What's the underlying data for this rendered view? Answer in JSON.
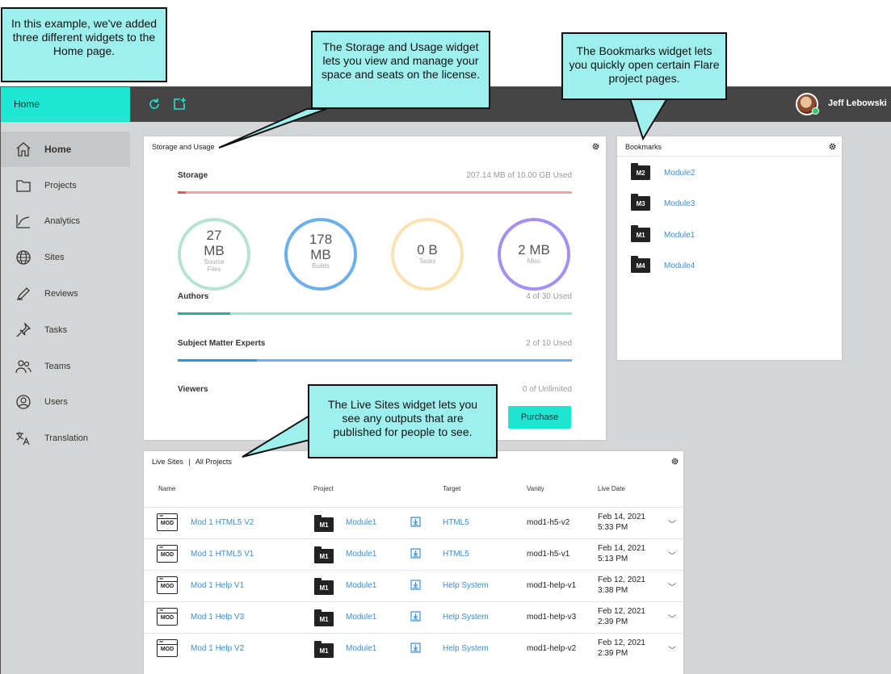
{
  "topbar": {
    "home_tab": "Home",
    "user_name": "Jeff Lebowski",
    "icons": [
      "refresh-icon",
      "new-item-icon"
    ]
  },
  "sidebar": {
    "items": [
      {
        "label": "Home",
        "icon": "home-icon",
        "active": true
      },
      {
        "label": "Projects",
        "icon": "folder-icon"
      },
      {
        "label": "Analytics",
        "icon": "chart-icon"
      },
      {
        "label": "Sites",
        "icon": "globe-icon"
      },
      {
        "label": "Reviews",
        "icon": "pen-icon"
      },
      {
        "label": "Tasks",
        "icon": "pin-icon"
      },
      {
        "label": "Teams",
        "icon": "team-icon"
      },
      {
        "label": "Users",
        "icon": "user-icon"
      },
      {
        "label": "Translation",
        "icon": "translate-icon"
      }
    ]
  },
  "storage": {
    "title": "Storage and Usage",
    "storage_label": "Storage",
    "storage_used": "207.14 MB of 10.00 GB Used",
    "storage_fraction": 0.02,
    "rings": [
      {
        "value": "27",
        "unit": "MB",
        "label": "Source Files",
        "color": "#b7e3d3",
        "accent": "#a9d8c7"
      },
      {
        "value": "178",
        "unit": "MB",
        "label": "Builds",
        "color": "#6ab0ee",
        "accent": "#3b8fd6"
      },
      {
        "value": "0 B",
        "unit": "",
        "label": "Tasks",
        "color": "#fbe2b3",
        "accent": "#f5cf85"
      },
      {
        "value": "2 MB",
        "unit": "",
        "label": "Misc",
        "color": "#a78ef2",
        "accent": "#8b6de8"
      }
    ],
    "authors_label": "Authors",
    "authors_used": "4 of 30 Used",
    "authors_fraction": 0.133,
    "sme_label": "Subject Matter Experts",
    "sme_used": "2 of 10 Used",
    "sme_fraction": 0.2,
    "viewers_label": "Viewers",
    "viewers_used": "0 of Unlimited",
    "purchase": "Purchase",
    "colors": {
      "storage": "#f2a3a3",
      "storage_fill": "#e05a5a",
      "authors": "#a8ded3",
      "authors_fill": "#1eb39a",
      "sme": "#6ab0ee",
      "sme_fill": "#3b8fd6"
    }
  },
  "bookmarks": {
    "title": "Bookmarks",
    "items": [
      {
        "badge": "M2",
        "label": "Module2"
      },
      {
        "badge": "M3",
        "label": "Module3"
      },
      {
        "badge": "M1",
        "label": "Module1"
      },
      {
        "badge": "M4",
        "label": "Module4"
      }
    ]
  },
  "live_sites": {
    "title": "Live Sites",
    "filter": "All Projects",
    "separator": "|",
    "columns": [
      "Name",
      "Project",
      "Target",
      "Vanity",
      "Live Date"
    ],
    "rows": [
      {
        "icon": "MOD",
        "name": "Mod 1 HTML5 V2",
        "badge": "M1",
        "project": "Module1",
        "target": "HTML5",
        "vanity": "mod1-h5-v2",
        "date": "Feb 14, 2021",
        "time": "5:33 PM"
      },
      {
        "icon": "MOD",
        "name": "Mod 1 HTML5 V1",
        "badge": "M1",
        "project": "Module1",
        "target": "HTML5",
        "vanity": "mod1-h5-v1",
        "date": "Feb 14, 2021",
        "time": "5:13 PM"
      },
      {
        "icon": "MOD",
        "name": "Mod 1 Help V1",
        "badge": "M1",
        "project": "Module1",
        "target": "Help System",
        "vanity": "mod1-help-v1",
        "date": "Feb 12, 2021",
        "time": "3:38 PM"
      },
      {
        "icon": "MOD",
        "name": "Mod 1 Help V3",
        "badge": "M1",
        "project": "Module1",
        "target": "Help System",
        "vanity": "mod1-help-v3",
        "date": "Feb 12, 2021",
        "time": "2:39 PM"
      },
      {
        "icon": "MOD",
        "name": "Mod 1 Help V2",
        "badge": "M1",
        "project": "Module1",
        "target": "Help System",
        "vanity": "mod1-help-v2",
        "date": "Feb 12, 2021",
        "time": "2:39 PM"
      }
    ]
  },
  "callouts": {
    "intro": "In this example, we've added three different widgets to the Home page.",
    "storage": "The Storage and Usage widget lets you view and manage your space and seats on the license.",
    "bookmarks": "The Bookmarks widget lets you quickly open certain Flare project pages.",
    "live_sites": "The Live Sites widget lets you see any outputs that are published for people to see.",
    "color": "#9ef0ee"
  }
}
